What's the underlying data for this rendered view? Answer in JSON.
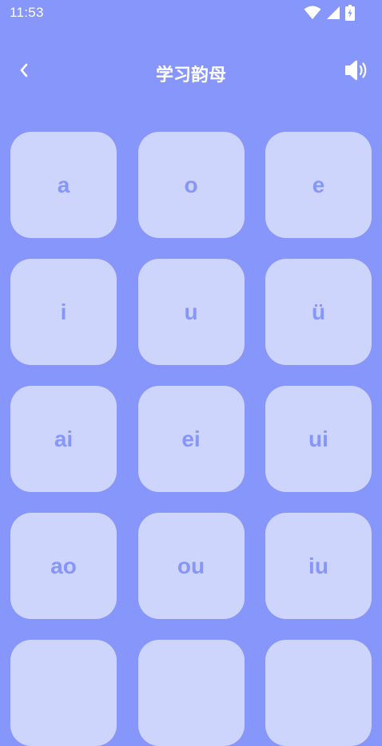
{
  "status_bar": {
    "time": "11:53",
    "icons": [
      "wifi-icon",
      "cellular-signal-icon",
      "battery-charging-icon"
    ]
  },
  "header": {
    "title": "学习韵母",
    "back_icon": "chevron-left-icon",
    "sound_icon": "speaker-icon"
  },
  "finals": [
    {
      "label": "a"
    },
    {
      "label": "o"
    },
    {
      "label": "e"
    },
    {
      "label": "i"
    },
    {
      "label": "u"
    },
    {
      "label": "ü"
    },
    {
      "label": "ai"
    },
    {
      "label": "ei"
    },
    {
      "label": "ui"
    },
    {
      "label": "ao"
    },
    {
      "label": "ou"
    },
    {
      "label": "iu"
    },
    {
      "label": ""
    },
    {
      "label": ""
    },
    {
      "label": ""
    }
  ],
  "colors": {
    "background": "#8696FA",
    "card": "#CED5FC",
    "card_text": "#8696FA",
    "header_text": "#FFFFFF"
  }
}
